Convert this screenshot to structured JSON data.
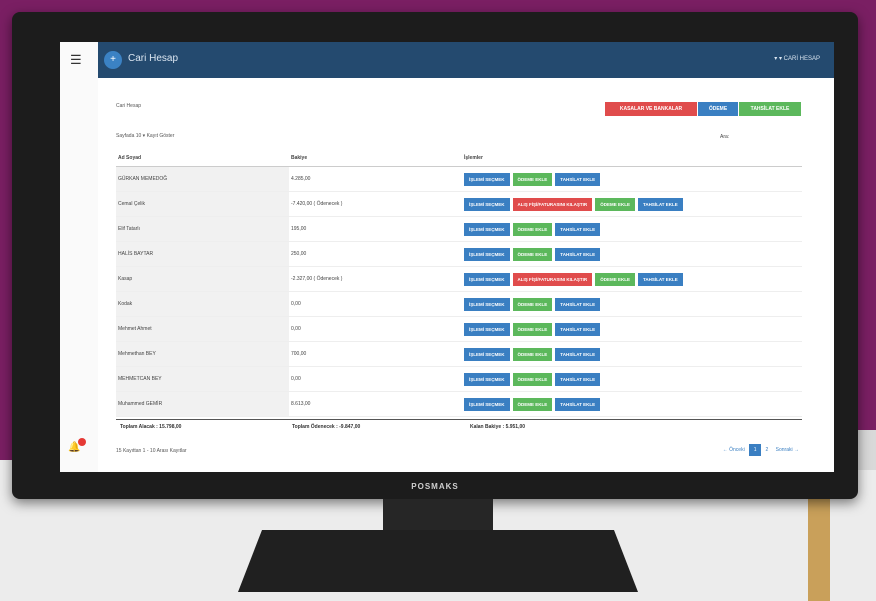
{
  "monitor": {
    "brand": "POSMAKS"
  },
  "topbar": {
    "title": "Cari Hesap",
    "right_text": "▾ ▾ CARİ HESAP",
    "circle_icon": "plus-circle-icon",
    "menu_icon": "hamburger-icon"
  },
  "header": {
    "breadcrumb": "Cari Hesap",
    "actions": [
      {
        "label": "KASALAR VE BANKALAR",
        "color": "#e04c4c"
      },
      {
        "label": "ÖDEME",
        "color": "#3a7fc2"
      },
      {
        "label": "TAHSİLAT EKLE",
        "color": "#5cb85c"
      }
    ],
    "page_length_label": "Sayfada  10  ▾  Kayıt Göster",
    "search_label": "Ara:"
  },
  "table": {
    "columns": [
      "Ad Soyad",
      "Bakiye",
      "İşlemler"
    ],
    "rows": [
      {
        "name": "GÜRKAN MEMEDOĞ",
        "balance": "4.285,00",
        "actions": [
          [
            "İŞLEMİ SEÇMEK",
            "blue"
          ],
          [
            "ÖDEME EKLE",
            "green"
          ],
          [
            "TAHSİLAT EKLE",
            "blue"
          ]
        ]
      },
      {
        "name": "Cemal Çelik",
        "balance": "-7.420,00 ( Ödenecek )",
        "actions": [
          [
            "İŞLEMİ SEÇMEK",
            "blue"
          ],
          [
            "ALIŞ FİŞİ/FATURASINI KILAŞTIR",
            "red"
          ],
          [
            "ÖDEME EKLE",
            "green"
          ],
          [
            "TAHSİLAT EKLE",
            "blue"
          ]
        ]
      },
      {
        "name": "Elif Tatarlı",
        "balance": "195,00",
        "actions": [
          [
            "İŞLEMİ SEÇMEK",
            "blue"
          ],
          [
            "ÖDEME EKLE",
            "green"
          ],
          [
            "TAHSİLAT EKLE",
            "blue"
          ]
        ]
      },
      {
        "name": "HALİS BAYTAR",
        "balance": "250,00",
        "actions": [
          [
            "İŞLEMİ SEÇMEK",
            "blue"
          ],
          [
            "ÖDEME EKLE",
            "green"
          ],
          [
            "TAHSİLAT EKLE",
            "blue"
          ]
        ]
      },
      {
        "name": "Kasap",
        "balance": "-2.327,00 ( Ödenecek )",
        "actions": [
          [
            "İŞLEMİ SEÇMEK",
            "blue"
          ],
          [
            "ALIŞ FİŞİ/FATURASINI KILAŞTIR",
            "red"
          ],
          [
            "ÖDEME EKLE",
            "green"
          ],
          [
            "TAHSİLAT EKLE",
            "blue"
          ]
        ]
      },
      {
        "name": "Kodak",
        "balance": "0,00",
        "actions": [
          [
            "İŞLEMİ SEÇMEK",
            "blue"
          ],
          [
            "ÖDEME EKLE",
            "green"
          ],
          [
            "TAHSİLAT EKLE",
            "blue"
          ]
        ]
      },
      {
        "name": "Mehmet Ahmet",
        "balance": "0,00",
        "actions": [
          [
            "İŞLEMİ SEÇMEK",
            "blue"
          ],
          [
            "ÖDEME EKLE",
            "green"
          ],
          [
            "TAHSİLAT EKLE",
            "blue"
          ]
        ]
      },
      {
        "name": "Mehmethan BEY",
        "balance": "700,00",
        "actions": [
          [
            "İŞLEMİ SEÇMEK",
            "blue"
          ],
          [
            "ÖDEME EKLE",
            "green"
          ],
          [
            "TAHSİLAT EKLE",
            "blue"
          ]
        ]
      },
      {
        "name": "MEHMETCAN BEY",
        "balance": "0,00",
        "actions": [
          [
            "İŞLEMİ SEÇMEK",
            "blue"
          ],
          [
            "ÖDEME EKLE",
            "green"
          ],
          [
            "TAHSİLAT EKLE",
            "blue"
          ]
        ]
      },
      {
        "name": "Muhammed GEMİR",
        "balance": "8.613,00",
        "actions": [
          [
            "İŞLEMİ SEÇMEK",
            "blue"
          ],
          [
            "ÖDEME EKLE",
            "green"
          ],
          [
            "TAHSİLAT EKLE",
            "blue"
          ]
        ]
      }
    ]
  },
  "totals": {
    "collection": "Toplam Alacak : 15.798,00",
    "payable": "Toplam Ödenecek : -9.847,00",
    "balance": "Kalan Bakiye : 5.951,00"
  },
  "footer": {
    "info": "15 Kayıttan 1 - 10 Arası Kayıtlar",
    "prev": "← Önceki",
    "pages": [
      "1",
      "2"
    ],
    "active_page": "1",
    "next": "Sonraki →"
  },
  "notifications": {
    "icon": "bell-icon",
    "badge_color": "#e53935"
  }
}
